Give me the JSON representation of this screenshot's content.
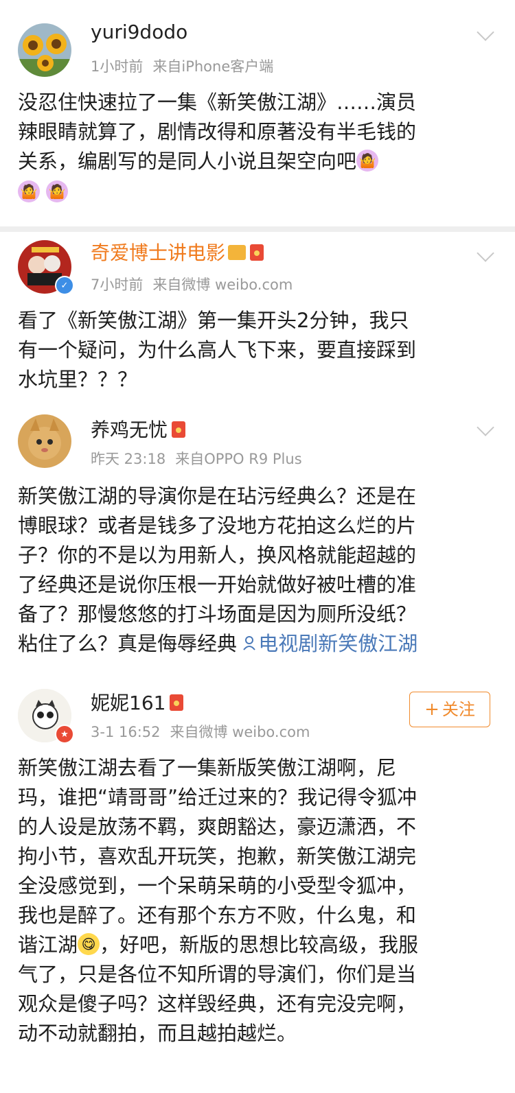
{
  "posts": [
    {
      "username": "yuri9dodo",
      "time": "1小时前",
      "source": "来自iPhone客户端",
      "lines": [
        "没忍住快速拉了一集《新笑傲江湖》……演员",
        "辣眼睛就算了，剧情改得和原著没有半毛钱的",
        "关系，编剧写的是同人小说且架空向吧"
      ],
      "emojis": [
        "person-shrugging-emoji",
        "person-shrugging-emoji",
        "person-shrugging-emoji"
      ]
    },
    {
      "username": "奇爱博士讲电影",
      "username_color": "#f07b1e",
      "time": "7小时前",
      "source": "来自微博 weibo.com",
      "lines": [
        "看了《新笑傲江湖》第一集开头2分钟，我只",
        "有一个疑问，为什么高人飞下来，要直接踩到",
        "水坑里？？？"
      ]
    },
    {
      "username": "养鸡无忧",
      "time": "昨天 23:18",
      "source": "来自OPPO R9 Plus",
      "lines": [
        "新笑傲江湖的导演你是在玷污经典么？还是在",
        "博眼球？或者是钱多了没地方花拍这么烂的片",
        "子？你的不是以为用新人，换风格就能超越的",
        "了经典还是说你压根一开始就做好被吐槽的准",
        "备了？那慢悠悠的打斗场面是因为厕所没纸？",
        "粘住了么？真是侮辱经典 "
      ],
      "link": "电视剧新笑傲江湖"
    },
    {
      "username": "妮妮161",
      "time": "3-1 16:52",
      "source": "来自微博 weibo.com",
      "follow": "关注",
      "follow_plus": "+",
      "lines": [
        "新笑傲江湖去看了一集新版笑傲江湖啊，尼",
        "玛，谁把“靖哥哥”给迁过来的？我记得令狐冲",
        "的人设是放荡不羁，爽朗豁达，豪迈潇洒，不",
        "拘小节，喜欢乱开玩笑，抱歉，新笑傲江湖完",
        "全没感觉到，一个呆萌呆萌的小受型令狐冲，",
        "我也是醉了。还有那个东方不败，什么鬼，和",
        "谐江湖",
        "气了，只是各位不知所谓的导演们，你们是当",
        "观众是傻子吗？这样毁经典，还有完没完啊，",
        "动不动就翻拍，而且越拍越烂。"
      ],
      "line7_after_emoji": "，好吧，新版的思想比较高级，我服"
    }
  ],
  "colors": {
    "verified_blue": "#3d8ee6",
    "red_badge": "#e94a35",
    "orange": "#f08a2c",
    "link_blue": "#4a79b8"
  }
}
